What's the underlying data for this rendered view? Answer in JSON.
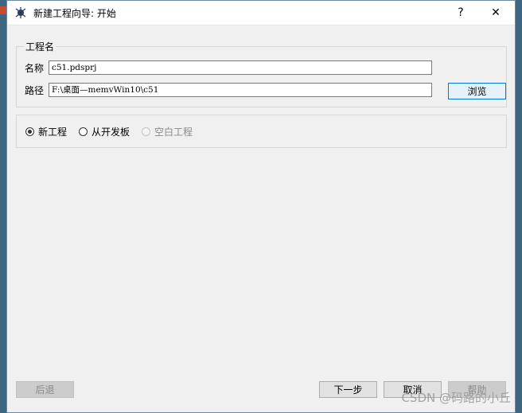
{
  "window": {
    "title": "新建工程向导: 开始",
    "help_label": "?",
    "close_label": "✕"
  },
  "project_group": {
    "title": "工程名",
    "name_label": "名称",
    "name_value": "c51.pdsprj",
    "path_label": "路径",
    "path_value": "F:\\桌面—memvWin10\\c51",
    "browse_label": "浏览"
  },
  "options": [
    {
      "label": "新工程",
      "selected": true,
      "disabled": false
    },
    {
      "label": "从开发板",
      "selected": false,
      "disabled": false
    },
    {
      "label": "空白工程",
      "selected": false,
      "disabled": true
    }
  ],
  "footer": {
    "back_label": "后退",
    "next_label": "下一步",
    "cancel_label": "取消",
    "help_label": "帮助"
  },
  "watermark": "CSDN @码路的小丘",
  "colors": {
    "accent": "#0078d7",
    "dialog_bg": "#f0f0f0"
  }
}
